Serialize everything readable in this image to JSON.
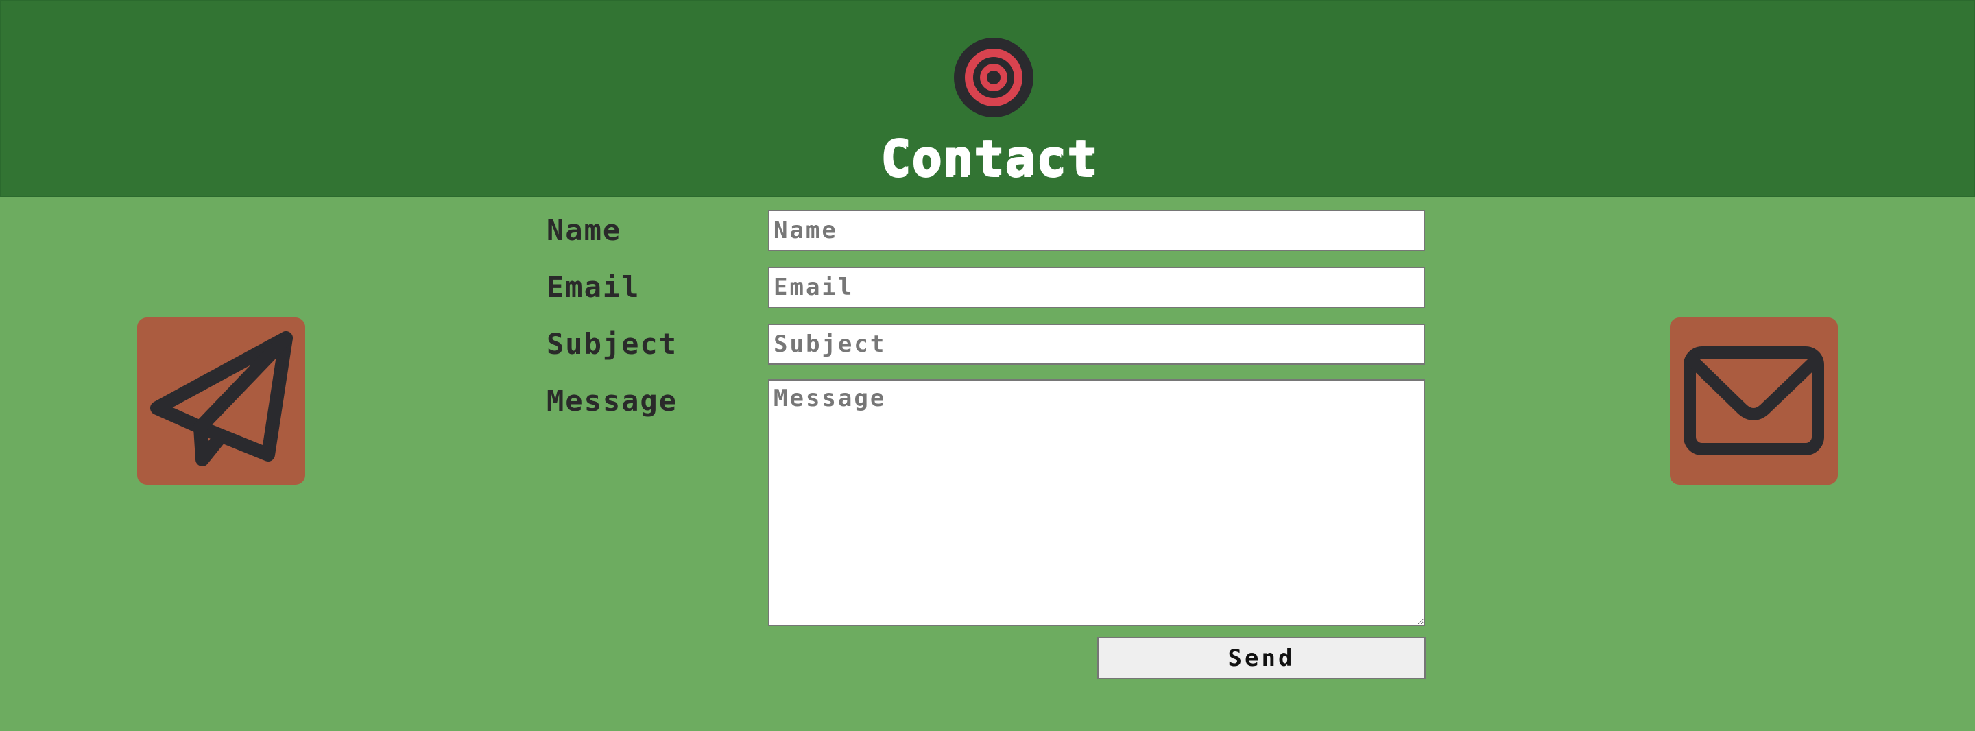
{
  "colors": {
    "header_bg": "#327433",
    "page_bg": "#6dac60",
    "icon_tile": "#ab5c40",
    "logo_ring": "#2a2a2e",
    "logo_accent": "#d9434f",
    "text_dark": "#2a2a2a"
  },
  "header": {
    "logo_icon": "target-icon",
    "title": "Contact"
  },
  "side_icons": {
    "left": "paper-plane-icon",
    "right": "envelope-icon"
  },
  "form": {
    "name": {
      "label": "Name",
      "placeholder": "Name",
      "value": ""
    },
    "email": {
      "label": "Email",
      "placeholder": "Email",
      "value": ""
    },
    "subject": {
      "label": "Subject",
      "placeholder": "Subject",
      "value": ""
    },
    "message": {
      "label": "Message",
      "placeholder": "Message",
      "value": ""
    },
    "send_label": "Send"
  }
}
